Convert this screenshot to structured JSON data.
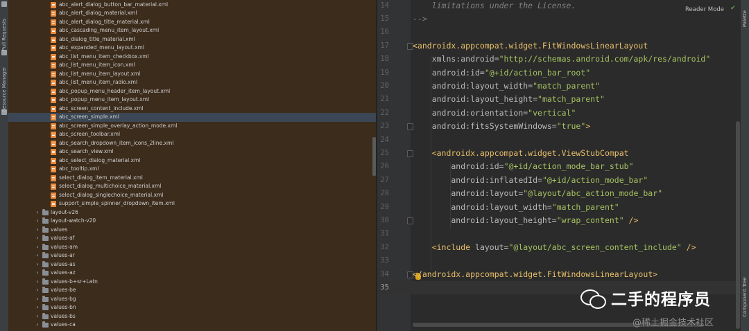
{
  "sidebar_left": {
    "tabs": [
      {
        "label": "Pull Requests",
        "icon": "pull-request-icon"
      },
      {
        "label": "Resource Manager",
        "icon": "resource-manager-icon"
      }
    ]
  },
  "project_tree": {
    "files": [
      "abc_alert_dialog_button_bar_material.xml",
      "abc_alert_dialog_material.xml",
      "abc_alert_dialog_title_material.xml",
      "abc_cascading_menu_item_layout.xml",
      "abc_dialog_title_material.xml",
      "abc_expanded_menu_layout.xml",
      "abc_list_menu_item_checkbox.xml",
      "abc_list_menu_item_icon.xml",
      "abc_list_menu_item_layout.xml",
      "abc_list_menu_item_radio.xml",
      "abc_popup_menu_header_item_layout.xml",
      "abc_popup_menu_item_layout.xml",
      "abc_screen_content_include.xml",
      "abc_screen_simple.xml",
      "abc_screen_simple_overlay_action_mode.xml",
      "abc_screen_toolbar.xml",
      "abc_search_dropdown_item_icons_2line.xml",
      "abc_search_view.xml",
      "abc_select_dialog_material.xml",
      "abc_tooltip.xml",
      "select_dialog_item_material.xml",
      "select_dialog_multichoice_material.xml",
      "select_dialog_singlechoice_material.xml",
      "support_simple_spinner_dropdown_item.xml"
    ],
    "selected_file": "abc_screen_simple.xml",
    "folders": [
      "layout-v26",
      "layout-watch-v20",
      "values",
      "values-af",
      "values-am",
      "values-ar",
      "values-as",
      "values-az",
      "values-b+sr+Latn",
      "values-be",
      "values-bg",
      "values-bn",
      "values-bs",
      "values-ca"
    ]
  },
  "editor": {
    "reader_mode_label": "Reader Mode",
    "current_line": 35,
    "lines": [
      {
        "n": "14",
        "tokens": [
          {
            "t": "comment",
            "v": "    limitations under the License."
          }
        ]
      },
      {
        "n": "15",
        "tokens": [
          {
            "t": "comment",
            "v": "-->"
          }
        ]
      },
      {
        "n": "16",
        "tokens": []
      },
      {
        "n": "17",
        "tokens": [
          {
            "t": "tag",
            "v": "<androidx.appcompat.widget.FitWindowsLinearLayout"
          }
        ]
      },
      {
        "n": "18",
        "tokens": [
          {
            "t": "attr",
            "v": "    xmlns:android="
          },
          {
            "t": "val",
            "v": "\"http://schemas.android.com/apk/res/android\""
          }
        ]
      },
      {
        "n": "19",
        "tokens": [
          {
            "t": "attr",
            "v": "    android:id="
          },
          {
            "t": "val",
            "v": "\"@+id/action_bar_root\""
          }
        ]
      },
      {
        "n": "20",
        "tokens": [
          {
            "t": "attr",
            "v": "    android:layout_width="
          },
          {
            "t": "val",
            "v": "\"match_parent\""
          }
        ]
      },
      {
        "n": "21",
        "tokens": [
          {
            "t": "attr",
            "v": "    android:layout_height="
          },
          {
            "t": "val",
            "v": "\"match_parent\""
          }
        ]
      },
      {
        "n": "22",
        "tokens": [
          {
            "t": "attr",
            "v": "    android:orientation="
          },
          {
            "t": "val",
            "v": "\"vertical\""
          }
        ]
      },
      {
        "n": "23",
        "tokens": [
          {
            "t": "attr",
            "v": "    android:fitsSystemWindows="
          },
          {
            "t": "val",
            "v": "\"true\""
          },
          {
            "t": "tag",
            "v": ">"
          }
        ]
      },
      {
        "n": "24",
        "tokens": []
      },
      {
        "n": "25",
        "tokens": [
          {
            "t": "tag",
            "v": "    <androidx.appcompat.widget.ViewStubCompat"
          }
        ]
      },
      {
        "n": "26",
        "tokens": [
          {
            "t": "attr",
            "v": "        android:id="
          },
          {
            "t": "val",
            "v": "\"@+id/action_mode_bar_stub\""
          }
        ]
      },
      {
        "n": "27",
        "tokens": [
          {
            "t": "attr",
            "v": "        android:inflatedId="
          },
          {
            "t": "val",
            "v": "\"@+id/action_mode_bar\""
          }
        ]
      },
      {
        "n": "28",
        "tokens": [
          {
            "t": "attr",
            "v": "        android:layout="
          },
          {
            "t": "val",
            "v": "\"@layout/abc_action_mode_bar\""
          }
        ]
      },
      {
        "n": "29",
        "tokens": [
          {
            "t": "attr",
            "v": "        android:layout_width="
          },
          {
            "t": "val",
            "v": "\"match_parent\""
          }
        ]
      },
      {
        "n": "30",
        "tokens": [
          {
            "t": "attr",
            "v": "        android:layout_height="
          },
          {
            "t": "val",
            "v": "\"wrap_content\""
          },
          {
            "t": "tag",
            "v": " />"
          }
        ]
      },
      {
        "n": "31",
        "tokens": []
      },
      {
        "n": "32",
        "tokens": [
          {
            "t": "tag",
            "v": "    <include "
          },
          {
            "t": "attr",
            "v": "layout="
          },
          {
            "t": "val",
            "v": "\"@layout/abc_screen_content_include\""
          },
          {
            "t": "tag",
            "v": " />"
          }
        ]
      },
      {
        "n": "33",
        "tokens": []
      },
      {
        "n": "34",
        "tokens": [
          {
            "t": "tag",
            "v": "</androidx.appcompat.widget.FitWindowsLinearLayout>"
          }
        ]
      },
      {
        "n": "35",
        "tokens": []
      }
    ]
  },
  "sidebar_right": {
    "tabs": [
      {
        "label": "Palette"
      },
      {
        "label": "Component Tree"
      }
    ]
  },
  "watermark": {
    "title": "二手的程序员",
    "site": "@稀土掘金技术社区"
  }
}
